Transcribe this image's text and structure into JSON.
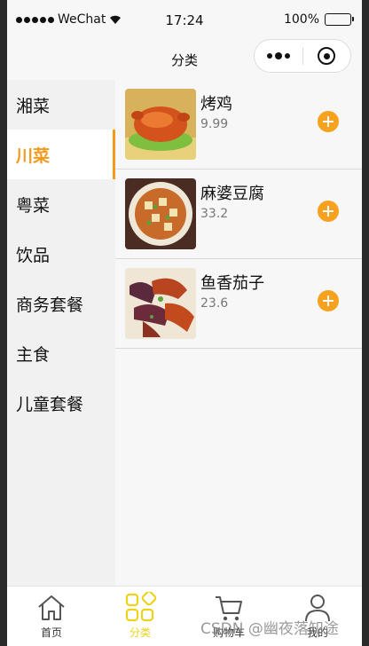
{
  "status_bar": {
    "carrier": "WeChat",
    "time": "17:24",
    "battery": "100%",
    "signal_icon": "signal-dots-icon",
    "wifi_icon": "wifi-icon",
    "battery_icon": "battery-icon"
  },
  "nav": {
    "title": "分类",
    "more_icon": "more-dots-icon",
    "close_icon": "target-close-icon"
  },
  "sidebar": {
    "items": [
      {
        "label": "湘菜",
        "active": false
      },
      {
        "label": "川菜",
        "active": true
      },
      {
        "label": "粤菜",
        "active": false
      },
      {
        "label": "饮品",
        "active": false
      },
      {
        "label": "商务套餐",
        "active": false
      },
      {
        "label": "主食",
        "active": false
      },
      {
        "label": "儿童套餐",
        "active": false
      }
    ]
  },
  "dishes": [
    {
      "name": "烤鸡",
      "price": "9.99",
      "image": "roast-chicken-image"
    },
    {
      "name": "麻婆豆腐",
      "price": "33.2",
      "image": "mapo-tofu-image"
    },
    {
      "name": "鱼香茄子",
      "price": "23.6",
      "image": "fish-flavored-eggplant-image"
    }
  ],
  "tabbar": {
    "tabs": [
      {
        "label": "首页",
        "icon": "home-icon",
        "active": false
      },
      {
        "label": "分类",
        "icon": "category-grid-icon",
        "active": true
      },
      {
        "label": "购物车",
        "icon": "cart-icon",
        "active": false
      },
      {
        "label": "我的",
        "icon": "user-icon",
        "active": false
      }
    ]
  },
  "watermark": "CSDN @幽夜落知途",
  "colors": {
    "accent": "#f39a1c",
    "add_button": "#f6a21e",
    "tab_active": "#ecd318",
    "sidebar_bg": "#f1f1f1",
    "page_bg": "#f7f7f7"
  }
}
